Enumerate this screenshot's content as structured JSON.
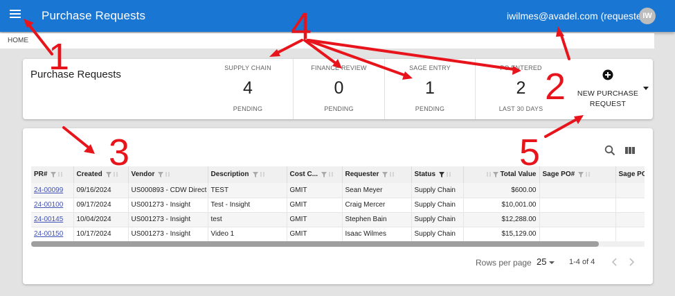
{
  "header": {
    "title": "Purchase Requests",
    "user_email": "iwilmes@avadel.com (requester)",
    "avatar_initials": "IW",
    "bg": "#1976d2"
  },
  "breadcrumb": {
    "home": "HOME"
  },
  "summary": {
    "title": "Purchase Requests",
    "stats": [
      {
        "label": "SUPPLY CHAIN",
        "value": "4",
        "sub": "PENDING"
      },
      {
        "label": "FINANCE REVIEW",
        "value": "0",
        "sub": "PENDING"
      },
      {
        "label": "SAGE ENTRY",
        "value": "1",
        "sub": "PENDING"
      },
      {
        "label": "PO ENTERED",
        "value": "2",
        "sub": "LAST 30 DAYS"
      }
    ],
    "new_button_line1": "NEW PURCHASE",
    "new_button_line2": "REQUEST"
  },
  "table": {
    "columns": [
      "PR#",
      "Created",
      "Vendor",
      "Description",
      "Cost C...",
      "Requester",
      "Status",
      "Total Value",
      "Sage PO#",
      "Sage PO"
    ],
    "rows": [
      {
        "pr": "24-00099",
        "created": "09/16/2024",
        "vendor": "US000893 - CDW Direct",
        "description": "TEST",
        "cost": "GMIT",
        "requester": "Sean Meyer",
        "status": "Supply Chain",
        "total": "$600.00",
        "sage_po": "",
        "sage_po2": ""
      },
      {
        "pr": "24-00100",
        "created": "09/17/2024",
        "vendor": "US001273 - Insight",
        "description": "Test - Insight",
        "cost": "GMIT",
        "requester": "Craig Mercer",
        "status": "Supply Chain",
        "total": "$10,001.00",
        "sage_po": "",
        "sage_po2": ""
      },
      {
        "pr": "24-00145",
        "created": "10/04/2024",
        "vendor": "US001273 - Insight",
        "description": "test",
        "cost": "GMIT",
        "requester": "Stephen Bain",
        "status": "Supply Chain",
        "total": "$12,288.00",
        "sage_po": "",
        "sage_po2": ""
      },
      {
        "pr": "24-00150",
        "created": "10/17/2024",
        "vendor": "US001273 - Insight",
        "description": "Video 1",
        "cost": "GMIT",
        "requester": "Isaac Wilmes",
        "status": "Supply Chain",
        "total": "$15,129.00",
        "sage_po": "",
        "sage_po2": ""
      }
    ],
    "link_color": "#3f51b5"
  },
  "pager": {
    "rows_per_page_label": "Rows per page",
    "rows_per_page": "25",
    "range": "1-4 of 4"
  },
  "annotations": {
    "color": "#e8141c",
    "labels": [
      "1",
      "2",
      "3",
      "4",
      "5"
    ]
  },
  "icons": [
    "menu-icon",
    "plus-circle-icon",
    "caret-down-icon",
    "search-icon",
    "columns-icon",
    "filter-icon",
    "sort-icon",
    "chevron-left-icon",
    "chevron-right-icon"
  ]
}
